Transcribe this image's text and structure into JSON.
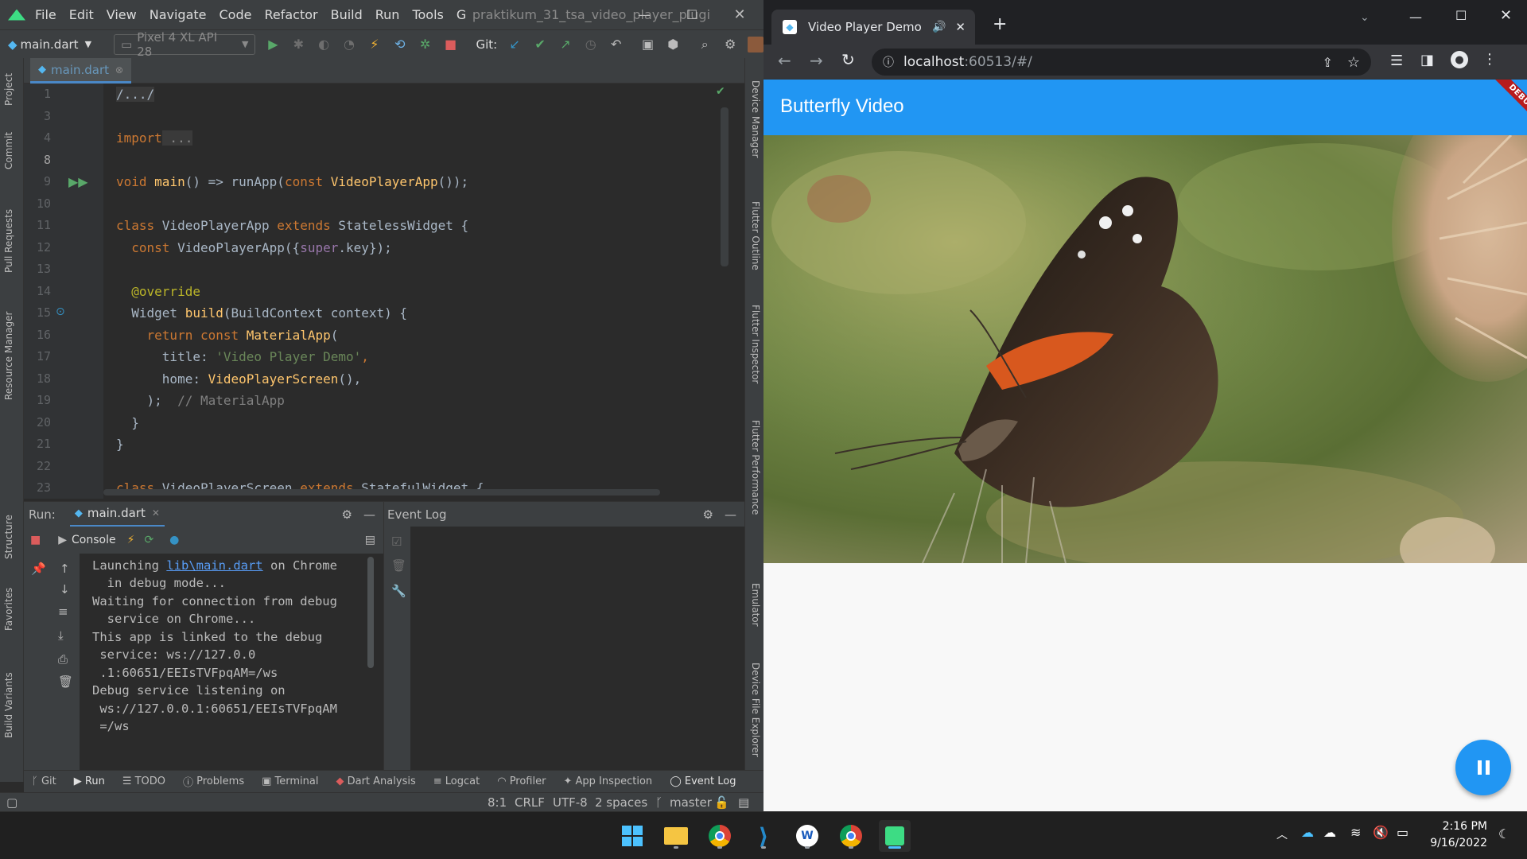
{
  "ide": {
    "menu": [
      "File",
      "Edit",
      "View",
      "Navigate",
      "Code",
      "Refactor",
      "Build",
      "Run",
      "Tools",
      "Git"
    ],
    "project_name": "praktikum_31_tsa_video_player_plugi",
    "run_config": "main.dart",
    "device": "Pixel 4 XL API 28",
    "git_label": "Git:",
    "left_tools": [
      "Project",
      "Commit",
      "Pull Requests",
      "Resource Manager",
      "Structure",
      "Favorites",
      "Build Variants"
    ],
    "right_tools": [
      "Device Manager",
      "Flutter Outline",
      "Flutter Inspector",
      "Flutter Performance",
      "Emulator",
      "Device File Explorer"
    ],
    "editor_tab": "main.dart",
    "line_numbers": [
      "1",
      "3",
      "4",
      "8",
      "9",
      "10",
      "11",
      "12",
      "13",
      "14",
      "15",
      "16",
      "17",
      "18",
      "19",
      "20",
      "21",
      "22",
      "23"
    ],
    "code": {
      "l1": "/.../",
      "l4a": "import",
      "l4b": " ...",
      "l9a": "void ",
      "l9b": "main",
      "l9c": "() => runApp(",
      "l9d": "const ",
      "l9e": "VideoPlayerApp",
      "l9f": "());",
      "l11a": "class ",
      "l11b": "VideoPlayerApp ",
      "l11c": "extends ",
      "l11d": "StatelessWidget {",
      "l12a": "  const ",
      "l12b": "VideoPlayerApp({",
      "l12c": "super",
      "l12d": ".key});",
      "l14": "  @override",
      "l15a": "  Widget ",
      "l15b": "build",
      "l15c": "(BuildContext context) {",
      "l16a": "    return const ",
      "l16b": "MaterialApp",
      "l16c": "(",
      "l17a": "      title: ",
      "l17b": "'Video Player Demo'",
      "l17c": ",",
      "l18a": "      home: ",
      "l18b": "VideoPlayerScreen",
      "l18c": "(),",
      "l19a": "    );  ",
      "l19b": "// MaterialApp",
      "l20": "  }",
      "l21": "}",
      "l23a": "class ",
      "l23b": "VideoPlayerScreen ",
      "l23c": "extends ",
      "l23d": "StatefulWidget {"
    },
    "run": {
      "label": "Run:",
      "tab": "main.dart",
      "console_label": "Console",
      "event_log_title": "Event Log",
      "console_lines": [
        "Launching ",
        "lib\\main.dart",
        " on Chrome",
        "  in debug mode...",
        "Waiting for connection from debug",
        "  service on Chrome...",
        "This app is linked to the debug",
        " service: ws://127.0.0",
        " .1:60651/EEIsTVFpqAM=/ws",
        "Debug service listening on",
        " ws://127.0.0.1:60651/EEIsTVFpqAM",
        " =/ws"
      ]
    },
    "bottom_tabs": [
      "Git",
      "Run",
      "TODO",
      "Problems",
      "Terminal",
      "Dart Analysis",
      "Logcat",
      "Profiler",
      "App Inspection",
      "Event Log"
    ],
    "status": {
      "position": "8:1",
      "line_sep": "CRLF",
      "encoding": "UTF-8",
      "indent": "2 spaces",
      "branch": "master"
    }
  },
  "browser": {
    "tab_title": "Video Player Demo",
    "url_host": "localhost",
    "url_rest": ":60513/#/",
    "app_title": "Butterfly Video",
    "debug_banner": "DEBUG"
  },
  "taskbar": {
    "time": "2:16 PM",
    "date": "9/16/2022"
  },
  "colors": {
    "flutter_blue": "#2196f3",
    "ide_bg": "#2b2b2b",
    "chrome_dark": "#202124"
  }
}
